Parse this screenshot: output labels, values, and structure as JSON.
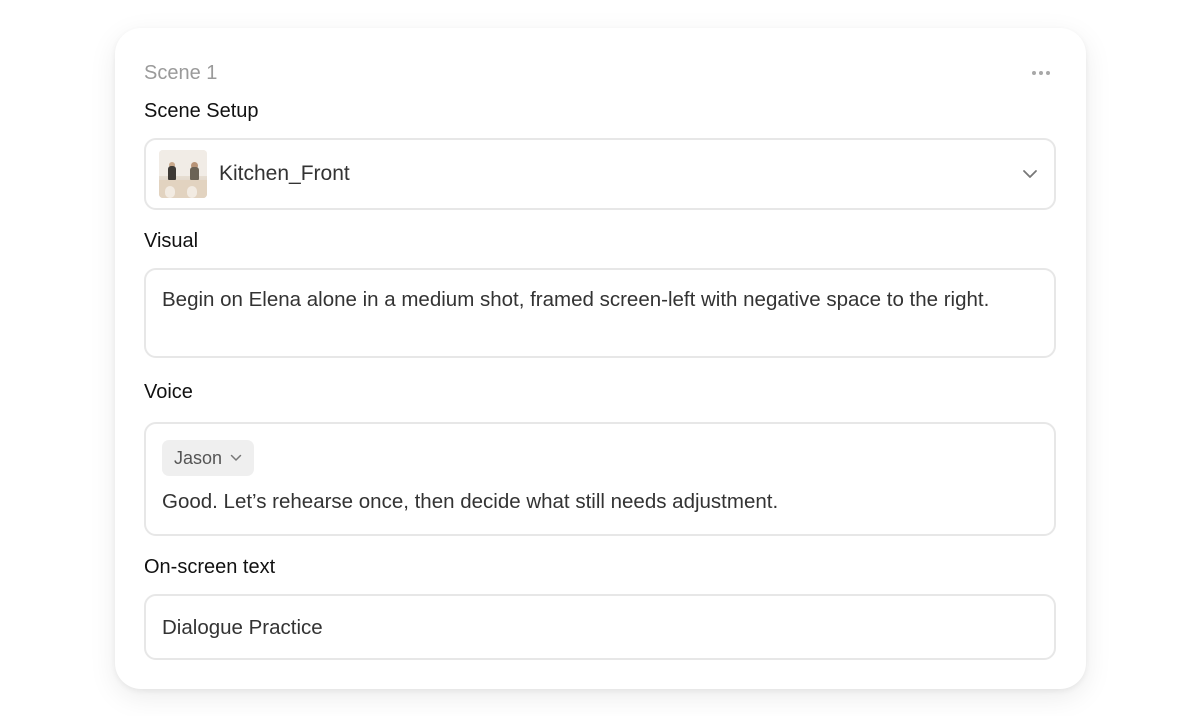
{
  "scene": {
    "title": "Scene 1",
    "more_icon": "more-horizontal-icon"
  },
  "setup": {
    "label": "Scene Setup",
    "selected": "Kitchen_Front",
    "chevron_icon": "chevron-down-icon"
  },
  "visual": {
    "label": "Visual",
    "value": "Begin on Elena alone in a medium shot, framed screen-left with negative space to the right."
  },
  "voice": {
    "label": "Voice",
    "speaker": "Jason",
    "line": "Good. Let’s rehearse once, then decide what still needs adjustment."
  },
  "onscreen": {
    "label": "On-screen text",
    "value": "Dialogue Practice"
  },
  "colors": {
    "card_bg": "#ffffff",
    "border": "#e7e7e7",
    "muted_text": "#9a9a9a",
    "pill_bg": "#efefef"
  }
}
